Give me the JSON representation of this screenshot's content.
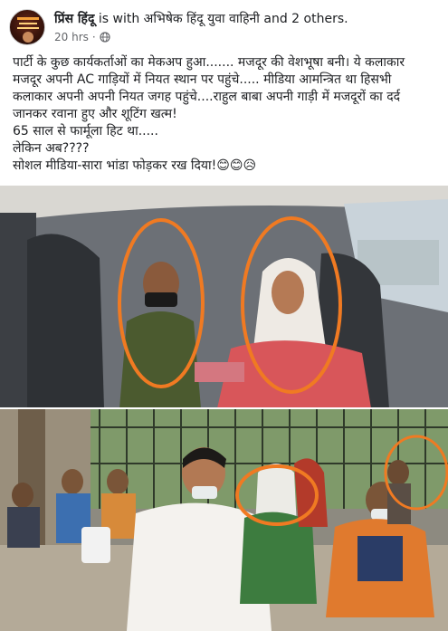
{
  "post": {
    "author": "प्रिंस हिंदू",
    "with_text": "is with अभिषेक हिंदू युवा वाहिनी and 2 others.",
    "time": "20 hrs",
    "dot": "·",
    "lines": [
      "पार्टी के कुछ कार्यकर्ताओं का मेकअप हुआ....... मजदूर की वेशभूषा बनी। ये कलाकार",
      "मजदूर अपनी AC गाड़ियों में नियत स्थान पर पहुंचे..... मीडिया आमन्त्रित था हिसभी",
      "कलाकार अपनी अपनी नियत जगह पहुंचे....राहुल बाबा अपनी गाड़ी में मजदूरों का दर्द",
      "जानकर रवाना हुए और शूटिंग खत्म!",
      "65 साल से फार्मूला हिट था.....",
      "लेकिन अब????",
      "सोशल मीडिया-सारा भांडा फोड़कर रख दिया!😊😊😥"
    ]
  },
  "colors": {
    "highlight_circle": "#f07a22",
    "meta_gray": "#65676b"
  },
  "icons": {
    "privacy": "globe-icon"
  }
}
